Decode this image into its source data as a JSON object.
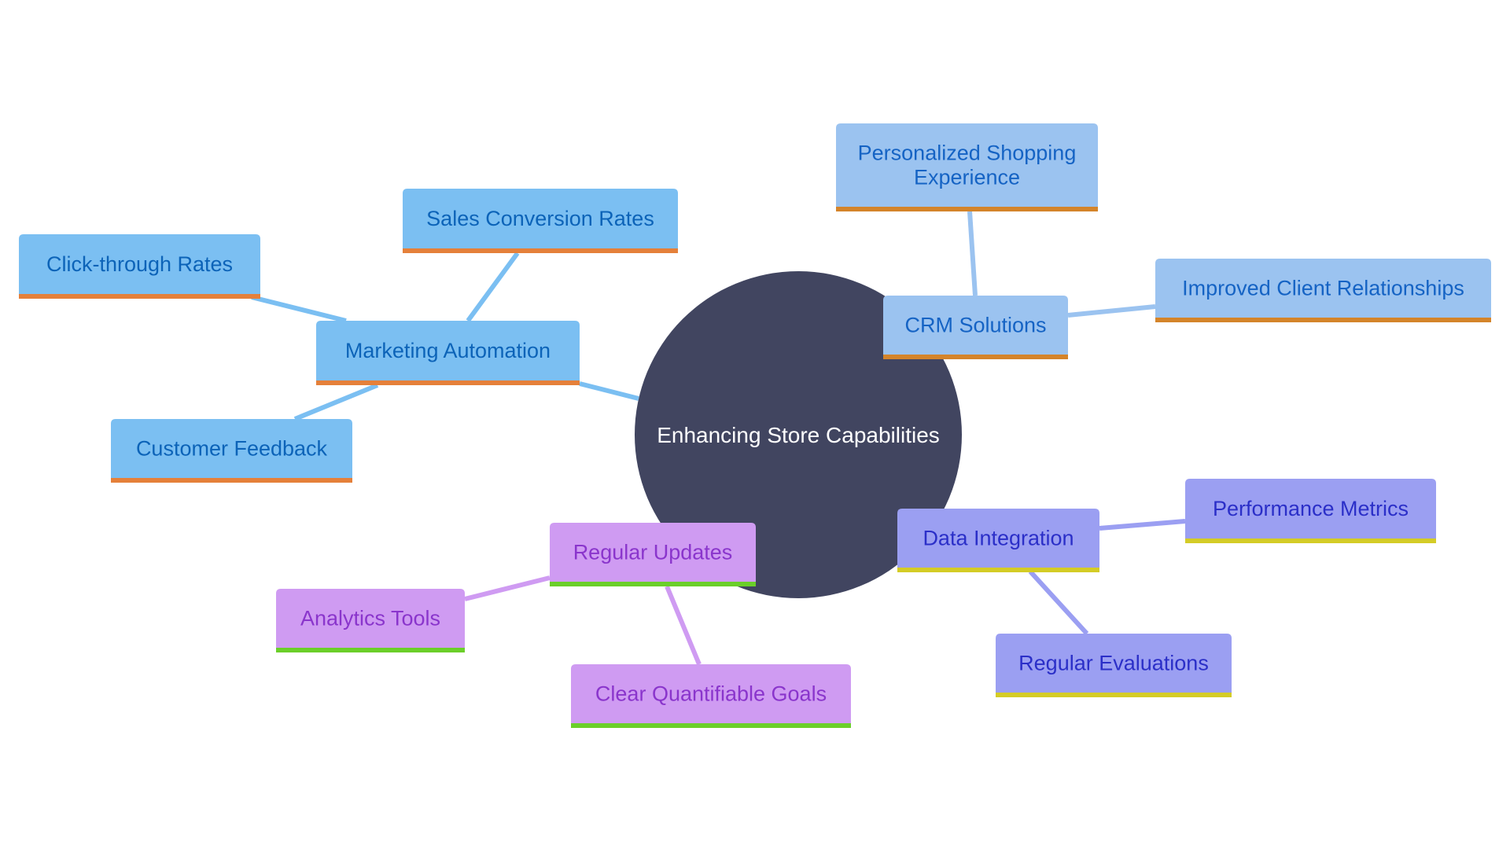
{
  "diagram": {
    "type": "mindmap",
    "root": {
      "id": "root",
      "label": "Enhancing Store Capabilities",
      "color": "#414560",
      "text_color": "#ffffff"
    },
    "branches": [
      {
        "id": "marketing",
        "label": "Marketing Automation",
        "theme": "blue",
        "children": [
          {
            "id": "sales",
            "label": "Sales Conversion Rates"
          },
          {
            "id": "click",
            "label": "Click-through Rates"
          },
          {
            "id": "feedback",
            "label": "Customer Feedback"
          }
        ]
      },
      {
        "id": "crm",
        "label": "CRM Solutions",
        "theme": "lightblue",
        "children": [
          {
            "id": "personalized",
            "label": "Personalized Shopping Experience",
            "lines": [
              "Personalized Shopping",
              "Experience"
            ]
          },
          {
            "id": "improved",
            "label": "Improved Client Relationships"
          }
        ]
      },
      {
        "id": "data",
        "label": "Data Integration",
        "theme": "indigo",
        "children": [
          {
            "id": "performance",
            "label": "Performance Metrics"
          },
          {
            "id": "evaluations",
            "label": "Regular Evaluations"
          }
        ]
      },
      {
        "id": "updates",
        "label": "Regular Updates",
        "theme": "purple",
        "children": [
          {
            "id": "analytics",
            "label": "Analytics Tools"
          },
          {
            "id": "goals",
            "label": "Clear Quantifiable Goals"
          }
        ]
      }
    ],
    "themes": {
      "blue": {
        "fill": "#7bbff2",
        "text": "#0c63b8",
        "border": "#e5803a",
        "edge": "#7bbff2"
      },
      "lightblue": {
        "fill": "#9bc3f0",
        "text": "#1563c4",
        "border": "#d4842a",
        "edge": "#9bc3f0"
      },
      "indigo": {
        "fill": "#9b9ff2",
        "text": "#2b2fc8",
        "border": "#d4cc26",
        "edge": "#9b9ff2"
      },
      "purple": {
        "fill": "#cf9bf2",
        "text": "#8a35cc",
        "border": "#6bcf2a",
        "edge": "#cf9bf2"
      }
    }
  }
}
